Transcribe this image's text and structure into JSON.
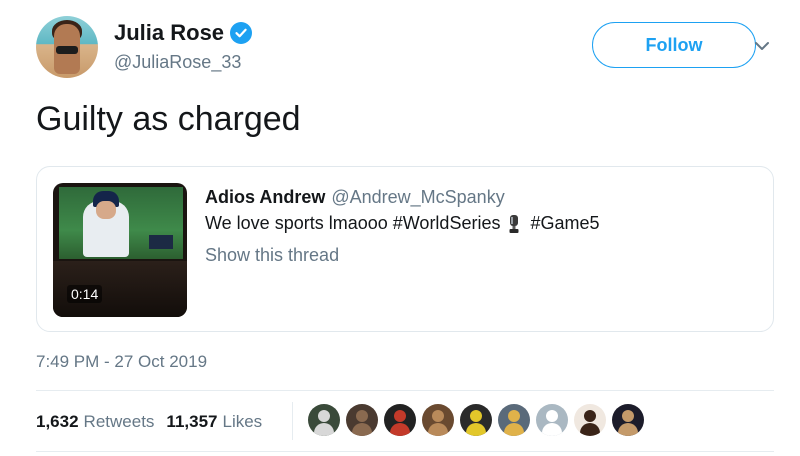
{
  "author": {
    "display_name": "Julia Rose",
    "handle": "@JuliaRose_33",
    "verified": true
  },
  "follow_label": "Follow",
  "tweet": {
    "text": "Guilty as charged",
    "timestamp": "7:49 PM - 27 Oct 2019"
  },
  "quoted_tweet": {
    "author_name": "Adios Andrew",
    "author_handle": "@Andrew_McSpanky",
    "text_before_emoji": "We love sports lmaooo #WorldSeries",
    "emoji_icon": "trophy-icon",
    "text_after_emoji": "#Game5",
    "show_thread_label": "Show this thread",
    "video_duration": "0:14"
  },
  "stats": {
    "retweets_count": "1,632",
    "retweets_label": "Retweets",
    "likes_count": "11,357",
    "likes_label": "Likes"
  },
  "liker_avatars": [
    {
      "bg": "#3a4a3a",
      "fg": "#d8d8d8"
    },
    {
      "bg": "#4a3a30",
      "fg": "#8a6a50"
    },
    {
      "bg": "#222222",
      "fg": "#c43a2a"
    },
    {
      "bg": "#6a4a30",
      "fg": "#b98a5a"
    },
    {
      "bg": "#2a2a2a",
      "fg": "#e2c72a"
    },
    {
      "bg": "#5a6a7a",
      "fg": "#e0b24a"
    },
    {
      "bg": "#aab8c2",
      "fg": "#ffffff"
    },
    {
      "bg": "#f0e8e0",
      "fg": "#3a2418"
    },
    {
      "bg": "#1c1c2a",
      "fg": "#c49a6a"
    }
  ],
  "colors": {
    "accent": "#1da1f2",
    "secondary_text": "#657786",
    "border": "#e1e8ed"
  }
}
